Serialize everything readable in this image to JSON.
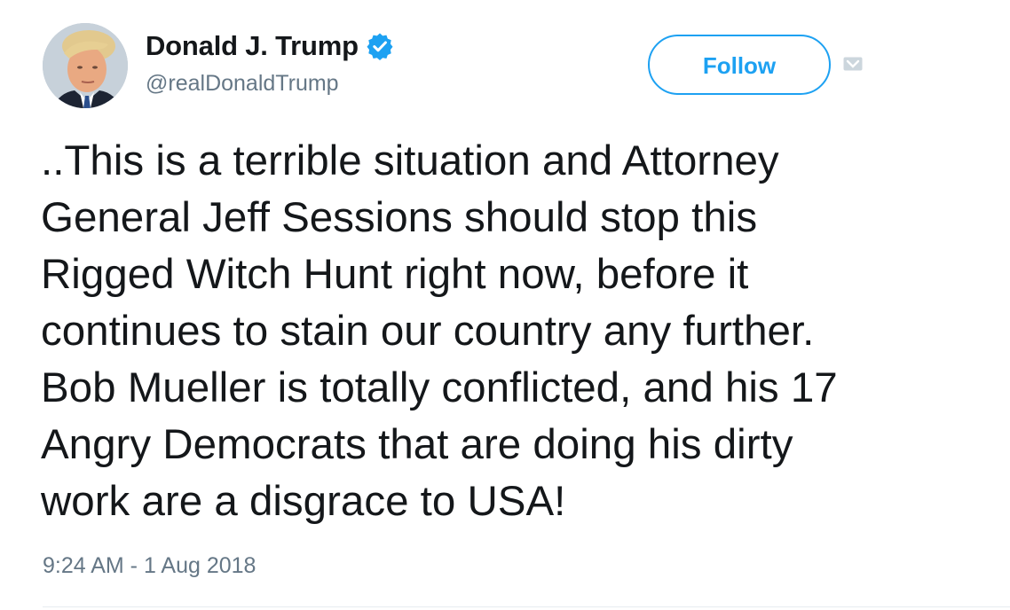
{
  "user": {
    "display_name": "Donald J. Trump",
    "handle": "@realDonaldTrump",
    "verified": true
  },
  "actions": {
    "follow_label": "Follow"
  },
  "tweet": {
    "lines": [
      "..This is a terrible situation and Attorney",
      "General Jeff Sessions should stop this",
      "Rigged Witch Hunt right now, before it",
      "continues to stain our country any further.",
      "Bob Mueller is totally conflicted, and his 17",
      "Angry Democrats that are doing his dirty",
      "work are a disgrace to USA!"
    ],
    "timestamp": "9:24 AM - 1 Aug 2018"
  },
  "colors": {
    "accent": "#1da1f2",
    "text": "#14171a",
    "secondary": "#657786"
  },
  "icons": {
    "verified": "verified-badge-icon",
    "menu": "caret-menu-icon",
    "avatar": "profile-photo"
  }
}
